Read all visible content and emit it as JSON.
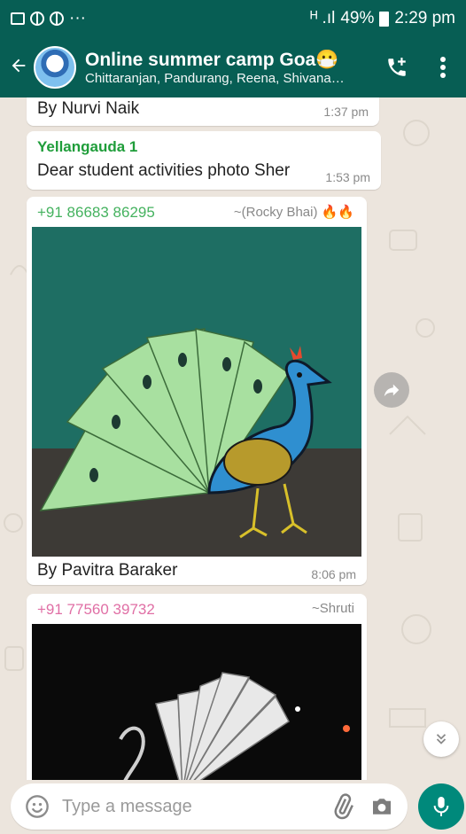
{
  "status_bar": {
    "signal_text": "ᴴ .ıl",
    "battery": "49%",
    "time": "2:29 pm",
    "overflow": "···"
  },
  "header": {
    "title": "Online summer camp Goa😷",
    "subtitle": "Chittaranjan, Pandurang, Reena, Shivanan..."
  },
  "messages": [
    {
      "text": "By Nurvi Naik",
      "time": "1:37 pm"
    },
    {
      "sender": "Yellangauda 1",
      "text": "Dear student activities photo Sher",
      "time": "1:53 pm"
    },
    {
      "sender": "+91 86683 86295",
      "handle": "~(Rocky Bhai) 🔥🔥",
      "caption": "By Pavitra Baraker",
      "time": "8:06 pm"
    },
    {
      "sender": "+91 77560 39732",
      "handle": "~Shruti"
    }
  ],
  "input": {
    "placeholder": "Type a message"
  },
  "colors": {
    "header": "#075e54",
    "mic": "#00897b",
    "chat_bg": "#ece5dd"
  },
  "icons": [
    "back-arrow-icon",
    "add-call-icon",
    "more-vert-icon",
    "forward-icon",
    "double-chevron-down-icon",
    "emoji-icon",
    "attach-icon",
    "camera-icon",
    "mic-icon"
  ]
}
